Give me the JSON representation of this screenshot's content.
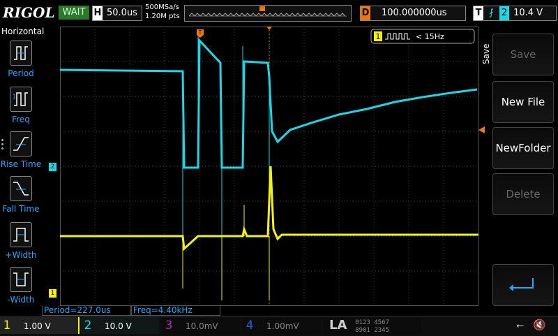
{
  "brand": "RIGOL",
  "run_state": "WAIT",
  "horizontal": {
    "letter": "H",
    "timebase": "50.0us"
  },
  "acquisition": {
    "sample_rate": "500MSa/s",
    "memory_depth": "1.20M pts"
  },
  "delay": {
    "letter": "D",
    "value": "100.000000us"
  },
  "trigger": {
    "letter": "T",
    "source": "2",
    "level": "10.4 V"
  },
  "left_menu": {
    "title": "Horizontal",
    "items": [
      {
        "label": "Period"
      },
      {
        "label": "Freq"
      },
      {
        "label": "Rise Time"
      },
      {
        "label": "Fall Time"
      },
      {
        "label": "+Width"
      },
      {
        "label": "-Width"
      }
    ]
  },
  "right_menu": {
    "title": "Save",
    "buttons": [
      {
        "label": "Save",
        "enabled": false
      },
      {
        "label": "New File",
        "enabled": true
      },
      {
        "label": "NewFolder",
        "enabled": true
      },
      {
        "label": "Delete",
        "enabled": false
      }
    ]
  },
  "counter": {
    "channel": "1",
    "text": "< 15Hz"
  },
  "measurements": {
    "period": "Period=227.0us",
    "freq": "Freq=4.40kHz"
  },
  "channels": [
    {
      "num": "1",
      "scale": "1.00 V",
      "color": "#f5f500",
      "active": true
    },
    {
      "num": "2",
      "scale": "10.0 V",
      "color": "#19d9e8",
      "active": true
    },
    {
      "num": "3",
      "scale": "10.0mV",
      "color": "#c21aa8",
      "active": false
    },
    {
      "num": "4",
      "scale": "1.00mV",
      "color": "#1f5fd8",
      "active": false
    }
  ],
  "la": {
    "label": "LA",
    "digits_top": "0123 4567",
    "digits_bottom": "8901 2345"
  },
  "markers": {
    "ch1_marker": "1",
    "ch2_marker": "2",
    "trigger_marker": "T"
  },
  "colors": {
    "ch1": "#f5f500",
    "ch2": "#19d9e8",
    "trigger": "#f07800",
    "accent": "#1fa8ff"
  }
}
